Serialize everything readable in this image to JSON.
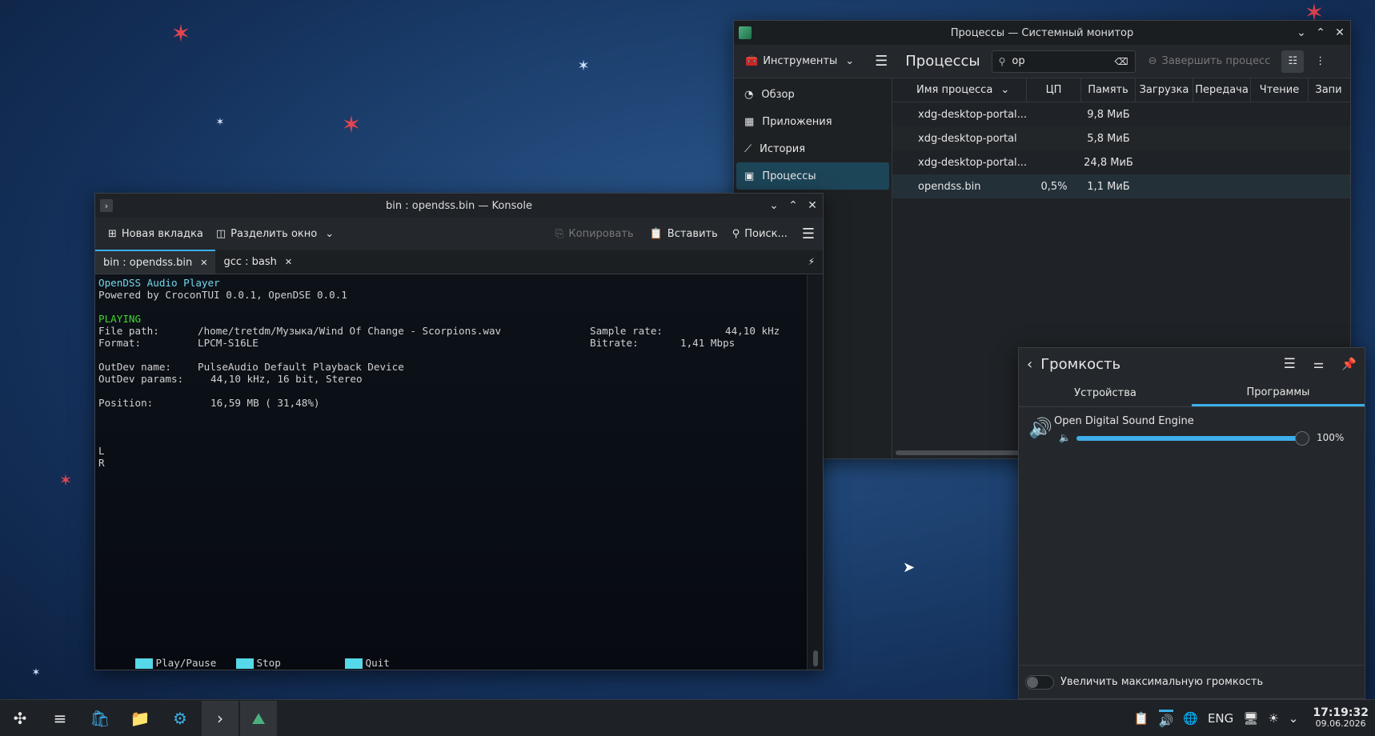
{
  "sysmon": {
    "title": "Процессы — Системный монитор",
    "tools_label": "Инструменты",
    "page_title": "Процессы",
    "search_value": "op",
    "end_process_label": "Завершить процесс",
    "sidebar": [
      {
        "label": "Обзор",
        "icon": "gauge-icon"
      },
      {
        "label": "Приложения",
        "icon": "grid-icon"
      },
      {
        "label": "История",
        "icon": "chart-icon"
      },
      {
        "label": "Процессы",
        "icon": "terminal-icon"
      }
    ],
    "columns": [
      "Имя процесса",
      "ЦП",
      "Память",
      "Загрузка",
      "Передача",
      "Чтение",
      "Запи"
    ],
    "rows": [
      {
        "name": "xdg-desktop-portal...",
        "cpu": "",
        "mem": "9,8 МиБ"
      },
      {
        "name": "xdg-desktop-portal",
        "cpu": "",
        "mem": "5,8 МиБ"
      },
      {
        "name": "xdg-desktop-portal...",
        "cpu": "",
        "mem": "24,8 МиБ"
      },
      {
        "name": "opendss.bin",
        "cpu": "0,5%",
        "mem": "1,1 МиБ"
      }
    ]
  },
  "konsole": {
    "title": "bin : opendss.bin — Konsole",
    "new_tab": "Новая вкладка",
    "split": "Разделить окно",
    "copy": "Копировать",
    "paste": "Вставить",
    "find": "Поиск...",
    "tabs": [
      {
        "label": "bin : opendss.bin"
      },
      {
        "label": "gcc : bash"
      }
    ],
    "term": {
      "l1": "OpenDSS Audio Player",
      "l2": "Powered by CroconTUI 0.0.1, OpenDSE 0.0.1",
      "status": "PLAYING",
      "filepath_label": "File path:",
      "filepath": "/home/tretdm/Музыка/Wind Of Change - Scorpions.wav",
      "samplerate_label": "Sample rate:",
      "samplerate": "44,10 kHz",
      "format_label": "Format:",
      "format": "LPCM-S16LE",
      "bitrate_label": "Bitrate:",
      "bitrate": "1,41 Mbps",
      "outdev_label": "OutDev name:",
      "outdev": "PulseAudio Default Playback Device",
      "params_label": "OutDev params:",
      "params": "44,10 kHz, 16 bit, Stereo",
      "position_label": "Position:",
      "position": "16,59 MB ( 31,48%)",
      "L": "L",
      "R": "R",
      "k_play": "Play/Pause",
      "k_stop": "Stop",
      "k_quit": "Quit"
    }
  },
  "volume": {
    "title": "Громкость",
    "tabs": [
      "Устройства",
      "Программы"
    ],
    "app_name": "Open Digital Sound Engine",
    "level_pct": "100%",
    "level": 1.0,
    "boost_label": "Увеличить максимальную громкость"
  },
  "taskbar": {
    "lang": "ENG",
    "time": "17:19:32",
    "date": "09.06.2026"
  },
  "colors": {
    "accent": "#3daee9",
    "selected": "#1d4558",
    "term_green": "#3fd62c",
    "term_cyan": "#74d7ec"
  }
}
